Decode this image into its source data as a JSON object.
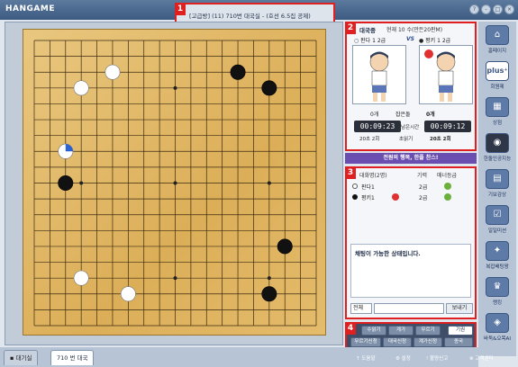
{
  "app": {
    "logo": "HANGAME"
  },
  "title_bar": {
    "badge": "1",
    "text": "[고급방] (11) 710번 대국실 - (호선 6.5집 공제)",
    "window_buttons": [
      "?",
      "-",
      "□",
      "×"
    ]
  },
  "game_panel": {
    "badge": "2",
    "status_label": "대국중",
    "move_info": "현재 10 수(만든20판M)",
    "player_white": {
      "name": "○ 판다 1 2급"
    },
    "vs": "VS",
    "player_black": {
      "name": "● 평키 1 2급"
    },
    "captures": {
      "white": "0개",
      "label": "잡은돌",
      "black": "0개"
    },
    "remaining_label": "남은시간",
    "time_white": "00:09:23",
    "time_black": "00:09:12",
    "byoyomi": {
      "white": "20초 2회",
      "label": "초읽기",
      "black": "20초 2회"
    },
    "banner": "전원의 행복, 한플 찬스!"
  },
  "user_list": {
    "badge": "3",
    "columns": [
      "대화명(2명)",
      "기력",
      "매너등급"
    ],
    "rows": [
      {
        "name": "판다1",
        "rank": "2급"
      },
      {
        "name": "평키1",
        "rank": "2급"
      }
    ]
  },
  "chat": {
    "message": "채팅이 가능한 상태입니다.",
    "input_mode": "전체",
    "send_label": "보내기"
  },
  "controls": {
    "badge": "4",
    "row1": [
      "수읽기",
      "계가",
      "무르기",
      "기권"
    ],
    "row2": [
      "무르기신청",
      "대국신청",
      "계가신청",
      "종국"
    ]
  },
  "sidebar": {
    "items": [
      {
        "label": "홈페이지",
        "icon": "home-icon"
      },
      {
        "label": "회원제",
        "icon": "plus-icon"
      },
      {
        "label": "상점",
        "icon": "shop-icon"
      },
      {
        "label": "한돌인공지능",
        "icon": "robot-icon"
      },
      {
        "label": "기보감상",
        "icon": "record-icon"
      },
      {
        "label": "일일미션",
        "icon": "mission-icon"
      },
      {
        "label": "복잡배팅왕",
        "icon": "bet-icon"
      },
      {
        "label": "랭킹",
        "icon": "trophy-icon"
      },
      {
        "label": "바둑&오목AI",
        "icon": "ai-icon"
      }
    ]
  },
  "bottom_tabs": [
    {
      "label": "대기실"
    },
    {
      "label": "710 번 대국"
    }
  ],
  "status_bar": [
    "↑ 도움말",
    "⚙ 설정",
    "! 불량신고",
    "⊗ 고객센터"
  ],
  "board": {
    "size": 19,
    "stones": [
      {
        "color": "white",
        "col": 5,
        "row": 2
      },
      {
        "color": "white",
        "col": 3,
        "row": 3
      },
      {
        "color": "black",
        "col": 13,
        "row": 2
      },
      {
        "color": "black",
        "col": 15,
        "row": 3
      },
      {
        "color": "white",
        "col": 2,
        "row": 7,
        "last": true
      },
      {
        "color": "black",
        "col": 2,
        "row": 9
      },
      {
        "color": "black",
        "col": 16,
        "row": 13
      },
      {
        "color": "white",
        "col": 3,
        "row": 15
      },
      {
        "color": "white",
        "col": 6,
        "row": 16
      },
      {
        "color": "black",
        "col": 15,
        "row": 16
      }
    ]
  }
}
